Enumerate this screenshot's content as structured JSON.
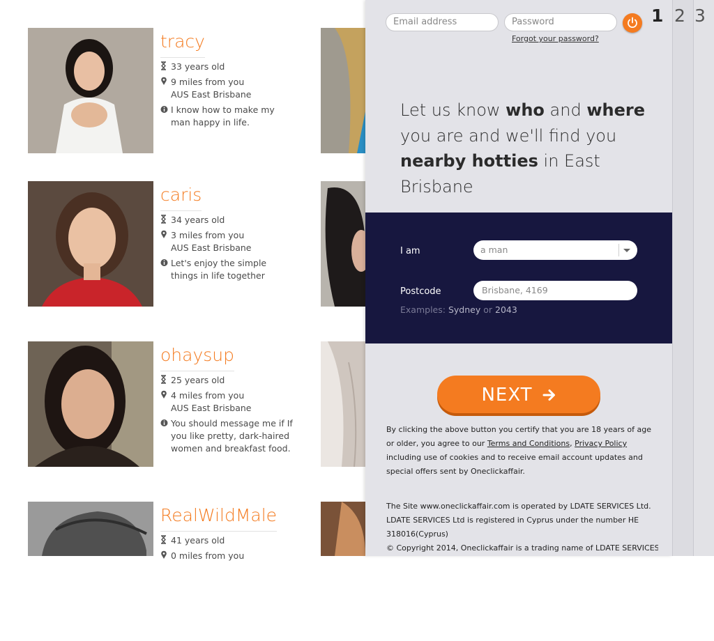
{
  "profiles": [
    {
      "name": "tracy",
      "age": "33 years old",
      "distance": "9 miles from you",
      "location": "AUS East Brisbane",
      "bio": "I know how to make my man happy in life."
    },
    {
      "name": "caris",
      "age": "34 years old",
      "distance": "3 miles from you",
      "location": "AUS East Brisbane",
      "bio": "Let's enjoy the simple things in life together"
    },
    {
      "name": "ohaysup",
      "age": "25 years old",
      "distance": "4 miles from you",
      "location": "AUS East Brisbane",
      "bio": "You should message me if If you like pretty, dark-haired women and breakfast food."
    },
    {
      "name": "RealWildMale",
      "age": "41 years old",
      "distance": "0 miles from you"
    }
  ],
  "login": {
    "email_placeholder": "Email address",
    "password_placeholder": "Password",
    "forgot_label": "Forgot your password?"
  },
  "steps": [
    "1",
    "2",
    "3"
  ],
  "headline": {
    "p1": "Let us know ",
    "b1": "who",
    "p2": " and ",
    "b2": "where",
    "p3": " you are and we'll find you ",
    "b3": "nearby hotties",
    "p4": " in East Brisbane"
  },
  "form": {
    "iam_label": "I am",
    "iam_value": "a man",
    "postcode_label": "Postcode",
    "postcode_placeholder": "Brisbane, 4169",
    "examples_prefix": "Examples:",
    "example1": "Sydney",
    "or_label": "or",
    "example2": "2043"
  },
  "next_label": "NEXT",
  "legal": {
    "p1a": "By clicking the above button you certify that you are 18 years of age or older, you agree to our ",
    "terms": "Terms and Conditions",
    "comma": ", ",
    "privacy": "Privacy Policy",
    "p1b": " including use of cookies and to receive email account updates and special offers sent by Oneclickaffair.",
    "p2": "The Site www.oneclickaffair.com is operated by LDATE SERVICES Ltd. LDATE SERVICES Ltd is registered in Cyprus under the number HE 318016(Cyprus)",
    "p3": "© Copyright 2014, Oneclickaffair is a trading name of LDATE SERVICES"
  },
  "colors": {
    "accent": "#f47b20",
    "form_bg": "#17173f",
    "panel_bg": "#e3e3e8"
  }
}
